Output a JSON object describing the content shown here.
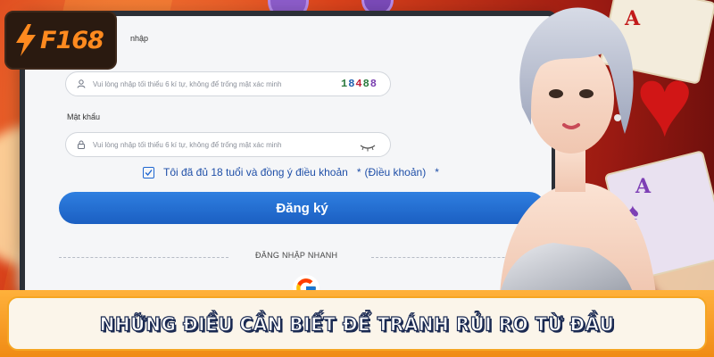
{
  "brand": {
    "logo_text": "F168",
    "logo_icon": "lightning-bolt-icon",
    "logo_color": "#ff8a1f"
  },
  "form": {
    "username_label": "nhập",
    "username_placeholder": "Vui lòng nhập tối thiểu 6 kí tự, không để trống mật xác minh",
    "captcha_code": "18488",
    "captcha_colors": [
      "#2b7a3d",
      "#1f5fb0",
      "#c21f3a",
      "#2b7a3d",
      "#7a3fb0"
    ],
    "password_label": "Mật khẩu",
    "password_placeholder": "Vui lòng nhập tối thiểu 6 kí tự, không để trống mật xác minh",
    "terms_checked": true,
    "terms_text": "Tôi đã đủ 18 tuổi và đồng ý điều khoản",
    "terms_req": "*",
    "terms_link": "(Điều khoản)",
    "terms_req2": "*",
    "register_button": "Đăng ký",
    "quick_login_label": "ĐĂNG NHẬP NHANH",
    "google_icon": "google-icon"
  },
  "banner": {
    "title": "NHỮNG ĐIỀU CẦN BIẾT ĐỂ TRÁNH RỦI RO TỪ ĐẦU"
  },
  "colors": {
    "primary_button": "#1b5fc2",
    "banner_orange": "#f08b14",
    "background_red": "#d9421b"
  }
}
